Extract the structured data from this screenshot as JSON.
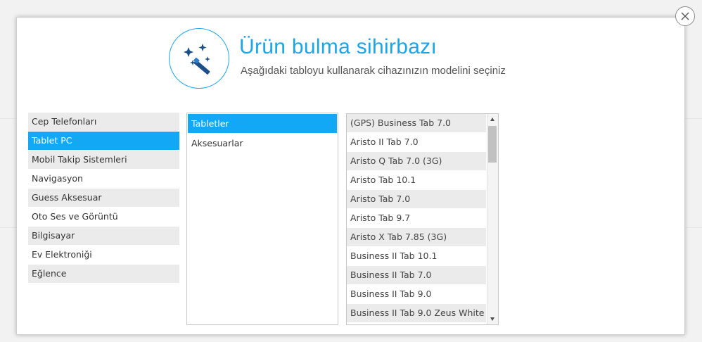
{
  "header": {
    "title": "Ürün bulma sihirbazı",
    "subtitle": "Aşağıdaki tabloyu kullanarak cihazınızın modelini seçiniz",
    "icon": "magic-wand-icon",
    "accent_color": "#1aa6e8"
  },
  "close_icon": "close-icon",
  "categories": [
    {
      "label": "Cep Telefonları"
    },
    {
      "label": "Tablet PC"
    },
    {
      "label": "Mobil Takip Sistemleri"
    },
    {
      "label": "Navigasyon"
    },
    {
      "label": "Guess Aksesuar"
    },
    {
      "label": "Oto Ses ve Görüntü"
    },
    {
      "label": "Bilgisayar"
    },
    {
      "label": "Ev Elektroniği"
    },
    {
      "label": "Eğlence"
    }
  ],
  "selected_category": "Tablet PC",
  "subcategories": [
    {
      "label": "Tabletler"
    },
    {
      "label": "Aksesuarlar"
    }
  ],
  "selected_subcategory": "Tabletler",
  "models": [
    {
      "label": "(GPS) Business Tab 7.0"
    },
    {
      "label": "Aristo II Tab 7.0"
    },
    {
      "label": "Aristo Q Tab 7.0 (3G)"
    },
    {
      "label": "Aristo Tab 10.1"
    },
    {
      "label": "Aristo Tab 7.0"
    },
    {
      "label": "Aristo Tab 9.7"
    },
    {
      "label": "Aristo X Tab 7.85 (3G)"
    },
    {
      "label": "Business II Tab 10.1"
    },
    {
      "label": "Business II Tab 7.0"
    },
    {
      "label": "Business II Tab 9.0"
    },
    {
      "label": "Business II Tab 9.0 Zeus White"
    }
  ],
  "selection_color": "#12a8f5"
}
